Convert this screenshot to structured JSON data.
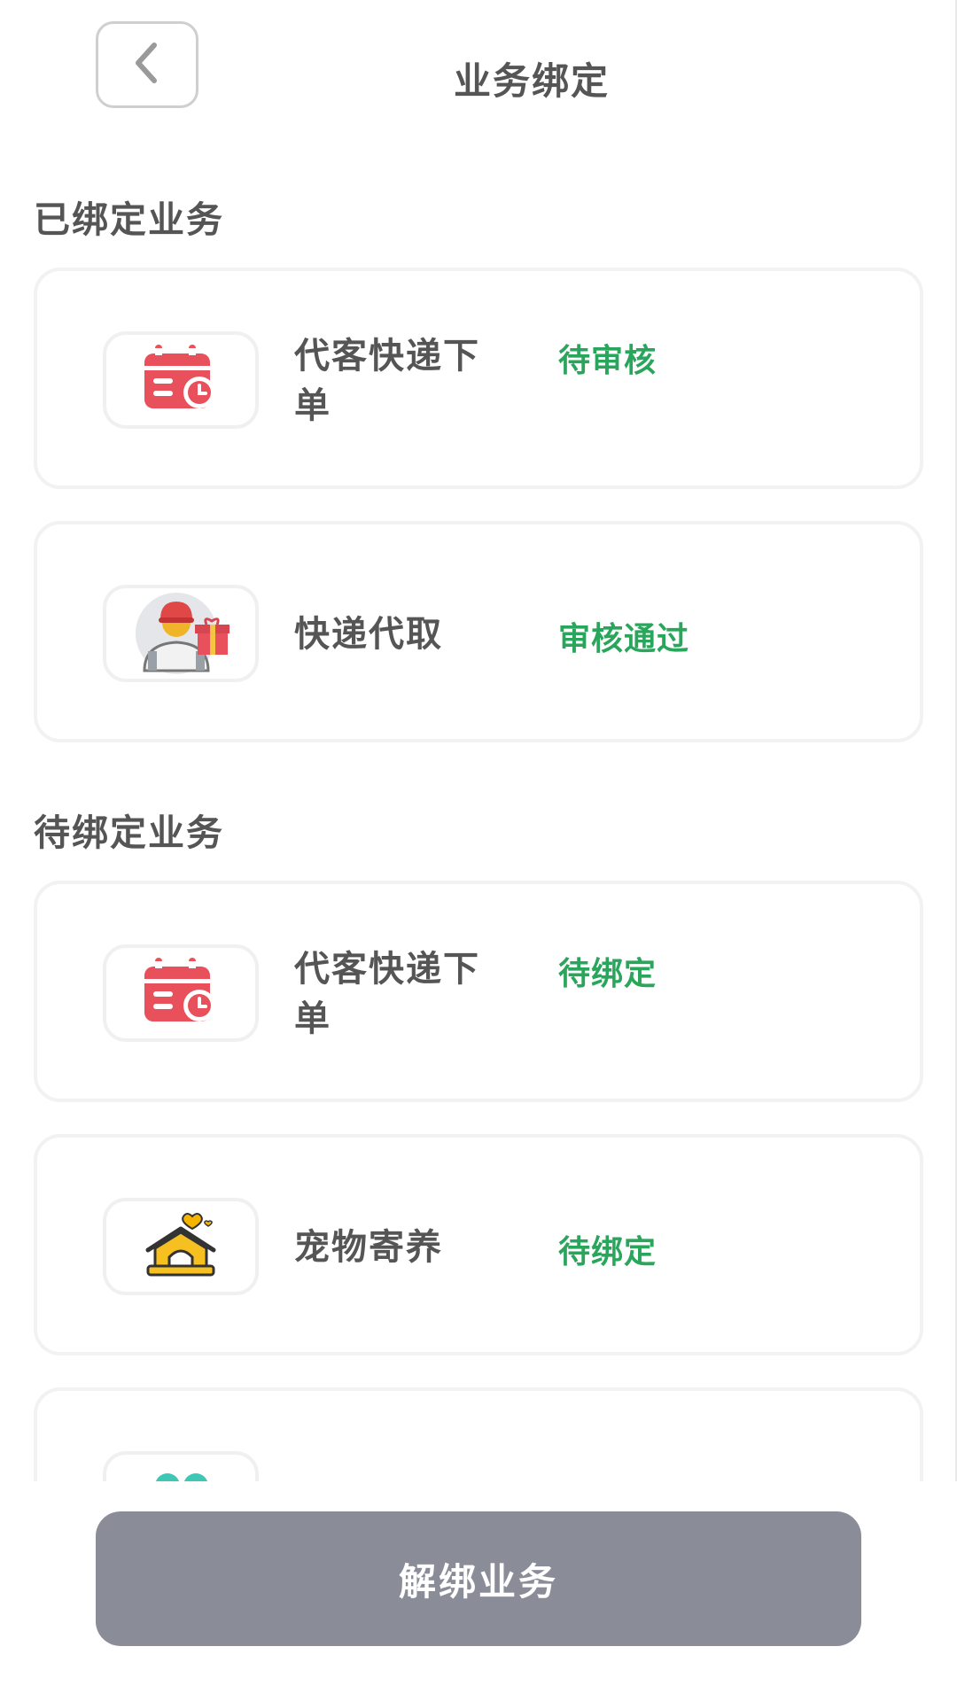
{
  "header": {
    "title": "业务绑定",
    "back_icon": "chevron-left-icon"
  },
  "bound_section": {
    "title": "已绑定业务",
    "items": [
      {
        "name": "代客快递下单",
        "status": "待审核",
        "icon": "calendar-clock-icon"
      },
      {
        "name": "快递代取",
        "status": "审核通过",
        "icon": "courier-with-gift-icon"
      }
    ]
  },
  "pending_section": {
    "title": "待绑定业务",
    "items": [
      {
        "name": "代客快递下单",
        "status": "待绑定",
        "icon": "calendar-clock-icon"
      },
      {
        "name": "宠物寄养",
        "status": "待绑定",
        "icon": "pet-house-icon"
      },
      {
        "name": "",
        "status": "",
        "icon": "people-icon"
      }
    ]
  },
  "footer": {
    "unbind_label": "解绑业务"
  },
  "colors": {
    "status_green": "#2aa55c",
    "button_gray": "#8a8c98",
    "text_gray": "#555555",
    "calendar_red": "#e8505b"
  }
}
